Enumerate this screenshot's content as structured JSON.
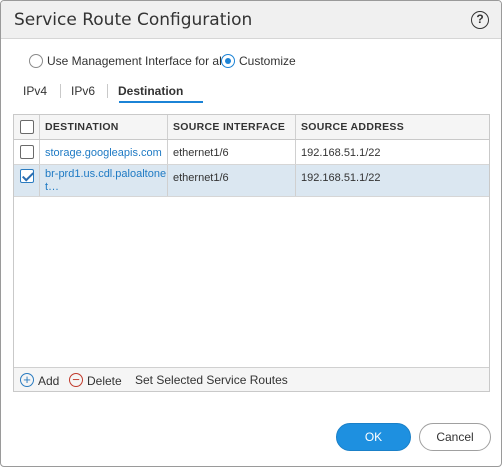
{
  "dialog": {
    "title": "Service Route Configuration",
    "help_label": "?"
  },
  "mode": {
    "options": [
      {
        "label": "Use Management Interface for all",
        "selected": false
      },
      {
        "label": "Customize",
        "selected": true
      }
    ]
  },
  "tabs": [
    {
      "label": "IPv4",
      "active": false
    },
    {
      "label": "IPv6",
      "active": false
    },
    {
      "label": "Destination",
      "active": true
    }
  ],
  "table": {
    "headers": [
      "DESTINATION",
      "SOURCE INTERFACE",
      "SOURCE ADDRESS"
    ],
    "rows": [
      {
        "destination": "storage.googleapis.com",
        "source_interface": "ethernet1/6",
        "source_address": "192.168.51.1/22",
        "checked": false
      },
      {
        "destination": "br-prd1.us.cdl.paloaltonet…",
        "source_interface": "ethernet1/6",
        "source_address": "192.168.51.1/22",
        "checked": true
      }
    ]
  },
  "footer": {
    "add_label": "Add",
    "delete_label": "Delete",
    "set_label": "Set Selected Service Routes"
  },
  "buttons": {
    "ok_label": "OK",
    "cancel_label": "Cancel"
  },
  "colors": {
    "accent": "#1b83d6",
    "selected_row": "#dbe7f1",
    "link": "#1e7ac4",
    "delete": "#c0392b"
  }
}
